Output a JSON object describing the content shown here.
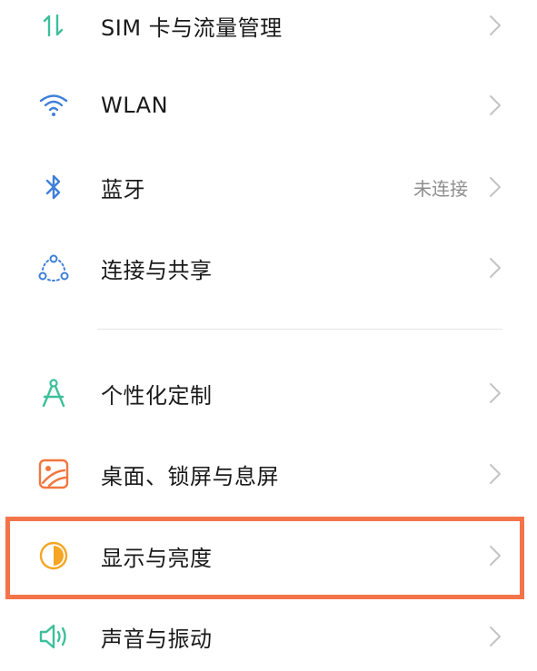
{
  "settings": {
    "items": [
      {
        "key": "sim",
        "label": "SIM 卡与流量管理",
        "value": "",
        "icon": "data-transfer-icon",
        "color": "#3dbf9b"
      },
      {
        "key": "wlan",
        "label": "WLAN",
        "value": "",
        "icon": "wifi-icon",
        "color": "#3f7fd9"
      },
      {
        "key": "bluetooth",
        "label": "蓝牙",
        "value": "未连接",
        "icon": "bluetooth-icon",
        "color": "#3f7fd9"
      },
      {
        "key": "share",
        "label": "连接与共享",
        "value": "",
        "icon": "connection-share-icon",
        "color": "#3f7fd9"
      },
      {
        "key": "personalize",
        "label": "个性化定制",
        "value": "",
        "icon": "compass-icon",
        "color": "#3dbf9b"
      },
      {
        "key": "wallpaper",
        "label": "桌面、锁屏与息屏",
        "value": "",
        "icon": "wallpaper-icon",
        "color": "#f0773f"
      },
      {
        "key": "display",
        "label": "显示与亮度",
        "value": "",
        "icon": "brightness-icon",
        "color": "#f5a623"
      },
      {
        "key": "sound",
        "label": "声音与振动",
        "value": "",
        "icon": "speaker-icon",
        "color": "#3dbf9b"
      }
    ]
  },
  "highlight_color": "#f4744a"
}
